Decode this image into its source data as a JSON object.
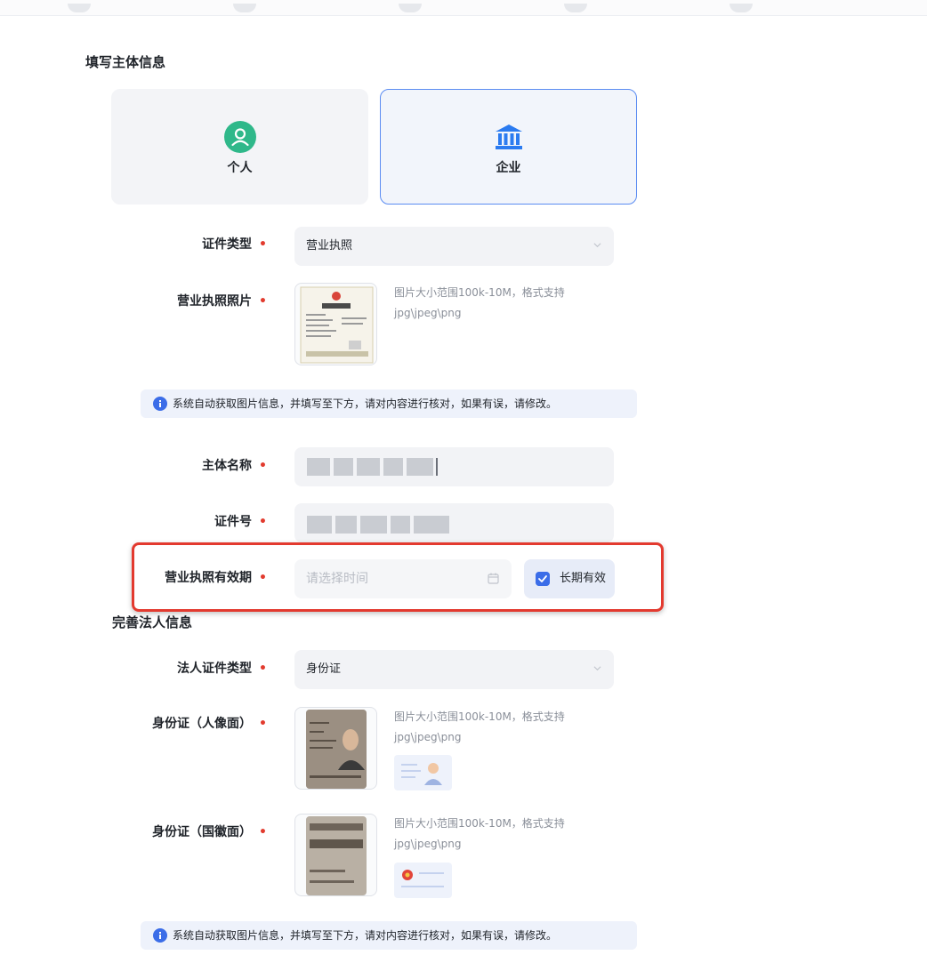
{
  "section1_title": "填写主体信息",
  "entity_types": [
    {
      "label": "个人",
      "selected": false
    },
    {
      "label": "企业",
      "selected": true
    }
  ],
  "cert_type": {
    "label": "证件类型",
    "value": "营业执照"
  },
  "license_photo": {
    "label": "营业执照照片",
    "hint_line1": "图片大小范围100k-10M，格式支持",
    "hint_line2": "jpg\\jpeg\\png"
  },
  "notice_text": "系统自动获取图片信息，并填写至下方，请对内容进行核对，如果有误，请修改。",
  "entity_name": {
    "label": "主体名称"
  },
  "cert_number": {
    "label": "证件号"
  },
  "license_validity": {
    "label": "营业执照有效期",
    "placeholder": "请选择时间",
    "long_term_label": "长期有效",
    "long_term_checked": true
  },
  "section2_title": "完善法人信息",
  "legal_cert_type": {
    "label": "法人证件类型",
    "value": "身份证"
  },
  "id_front": {
    "label": "身份证（人像面）",
    "hint_line1": "图片大小范围100k-10M，格式支持",
    "hint_line2": "jpg\\jpeg\\png"
  },
  "id_back": {
    "label": "身份证（国徽面）",
    "hint_line1": "图片大小范围100k-10M，格式支持",
    "hint_line2": "jpg\\jpeg\\png"
  },
  "notice_text_2": "系统自动获取图片信息，并填写至下方，请对内容进行核对，如果有误，请修改。",
  "required_mark": "•",
  "colors": {
    "accent": "#3b6de8",
    "required": "#e23b2e",
    "highlight": "#e33a2f",
    "person_icon": "#2fb88a",
    "enterprise_icon": "#2b7bf0"
  }
}
